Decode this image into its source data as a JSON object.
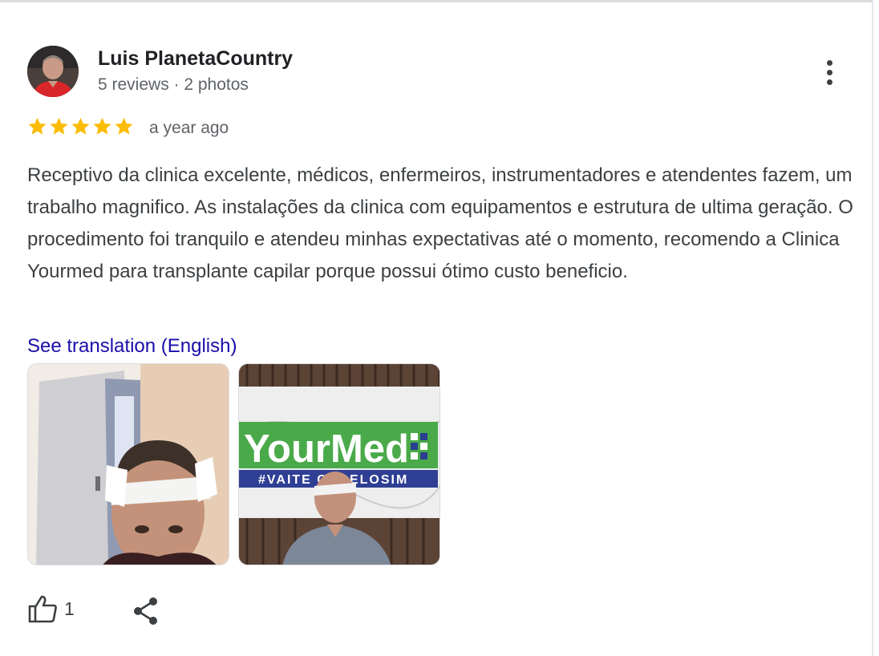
{
  "reviewer": {
    "name": "Luis PlanetaCountry",
    "stats": "5 reviews · 2 photos"
  },
  "rating": {
    "stars": 5,
    "max": 5,
    "color": "#fbbc04"
  },
  "time_ago": "a year ago",
  "review_text": "Receptivo da clinica excelente, médicos, enfermeiros, instrumentadores e atendentes fazem, um trabalho magnifico. As instalações da clinica com equipamentos e estrutura de ultima geração. O procedimento foi tranquilo e atendeu minhas expectativas até o momento, recomendo a Clinica Yourmed para transplante capilar porque possui ótimo custo beneficio.",
  "translate_link": "See translation (English)",
  "photos": {
    "photo2": {
      "logo_text": "YourMed",
      "banner_text": "#VAITE CABELOSIM"
    }
  },
  "actions": {
    "like_count": "1",
    "like_icon": "thumbs-up-icon",
    "share_icon": "share-icon",
    "more_icon": "more-vert-icon"
  },
  "colors": {
    "link": "#1a0dab",
    "star": "#fbbc04",
    "secondary_text": "#5f6368"
  }
}
